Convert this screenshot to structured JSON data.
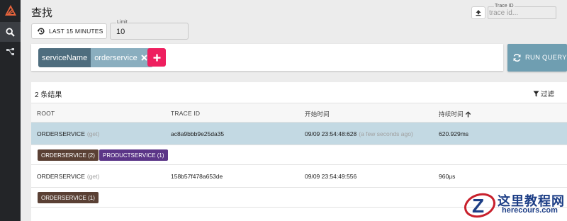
{
  "header": {
    "title": "查找",
    "trace_id_label": "Trace ID",
    "trace_id_placeholder": "trace id..."
  },
  "controls": {
    "time_range_label": "LAST 15 MINUTES",
    "limit_label": "Limit",
    "limit_value": "10",
    "run_query_label": "RUN QUERY"
  },
  "filters": [
    {
      "key": "serviceName",
      "value": "orderservice"
    }
  ],
  "results": {
    "count_label": "2 条结果",
    "filter_label": "过滤",
    "columns": [
      "ROOT",
      "TRACE ID",
      "开始时间",
      "持续时间"
    ],
    "rows": [
      {
        "root": "ORDERSERVICE",
        "method": "(get)",
        "trace_id": "ac8a9bbb9e25da35",
        "start": "09/09 23:54:48:628",
        "relative": "(a few seconds ago)",
        "duration": "620.929ms",
        "selected": true,
        "services": [
          {
            "label": "ORDERSERVICE (2)",
            "color": "#5a4034"
          },
          {
            "label": "PRODUCTSERVICE (1)",
            "color": "#5b3587"
          }
        ]
      },
      {
        "root": "ORDERSERVICE",
        "method": "(get)",
        "trace_id": "158b57f478a653de",
        "start": "09/09 23:54:49:556",
        "relative": "",
        "duration": "960μs",
        "selected": false,
        "services": [
          {
            "label": "ORDERSERVICE (1)",
            "color": "#5a4034"
          }
        ]
      }
    ]
  },
  "watermark": {
    "cn": "这里教程网",
    "en": "herecours.com"
  },
  "colors": {
    "rail": "#232528",
    "accent_pink": "#ee1f5f",
    "run_button": "#6f9eb1",
    "selected_row": "#c3d9e3"
  },
  "icons": {
    "logo": "zipkin-logo-icon",
    "nav_search": "search-icon",
    "nav_deps": "dependencies-icon",
    "upload": "upload-icon",
    "history": "history-icon",
    "close": "close-icon",
    "add": "plus-icon",
    "refresh": "refresh-icon",
    "filter": "filter-icon",
    "sort": "arrow-up-icon"
  }
}
